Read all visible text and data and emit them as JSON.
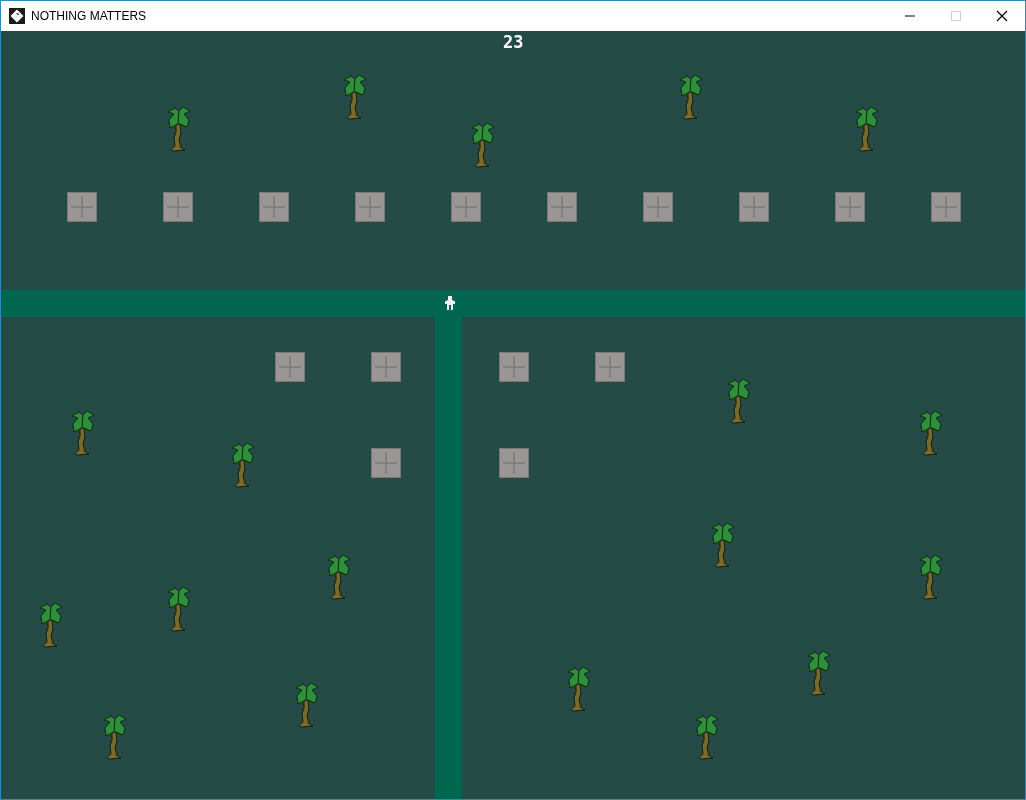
{
  "window": {
    "title": "NOTHING MATTERS",
    "maximize_disabled": true
  },
  "game": {
    "score": "23"
  }
}
